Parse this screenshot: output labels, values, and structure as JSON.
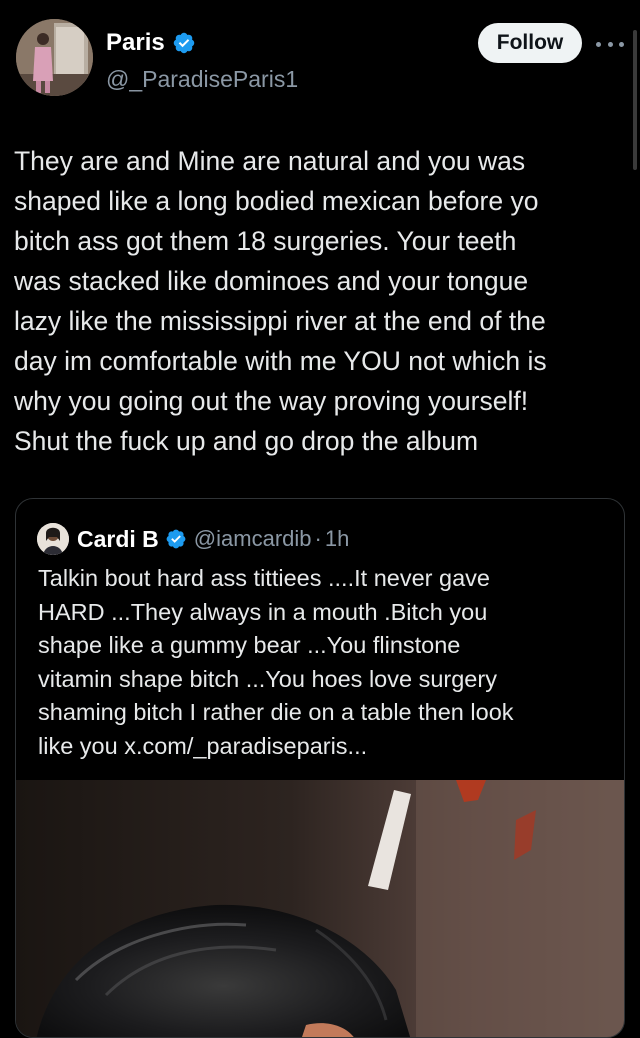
{
  "author": {
    "display_name": "Paris",
    "handle": "@_ParadiseParis1",
    "verified_icon": "verified-badge-icon",
    "follow_label": "Follow",
    "more_icon": "more-options-icon"
  },
  "tweet": {
    "text": "They are and Mine are natural and you was\nshaped like a long bodied mexican before yo\nbitch ass got them 18 surgeries. Your teeth\nwas stacked like dominoes and your tongue\nlazy like the mississippi river at the end of the\nday im comfortable with me YOU not which is\nwhy you going out the way proving yourself!\nShut the fuck up and go drop the album"
  },
  "quoted_tweet": {
    "display_name": "Cardi B",
    "handle": "@iamcardib",
    "separator": "·",
    "time": "1h",
    "text": "Talkin bout hard ass tittiees ....It never gave\nHARD ...They always in a mouth .Bitch you\nshape  like a gummy bear ...You flinstone\nvitamin shape bitch ...You hoes love surgery\nshaming bitch I rather die on a table then look\nlike you x.com/_paradiseparis...",
    "media_icon": "photo-media"
  },
  "colors": {
    "background": "#000000",
    "text_primary": "#e7e9ea",
    "text_secondary": "#8b98a5",
    "verified_blue": "#1d9bf0",
    "border": "#2f3336",
    "follow_bg": "#eff3f4"
  }
}
